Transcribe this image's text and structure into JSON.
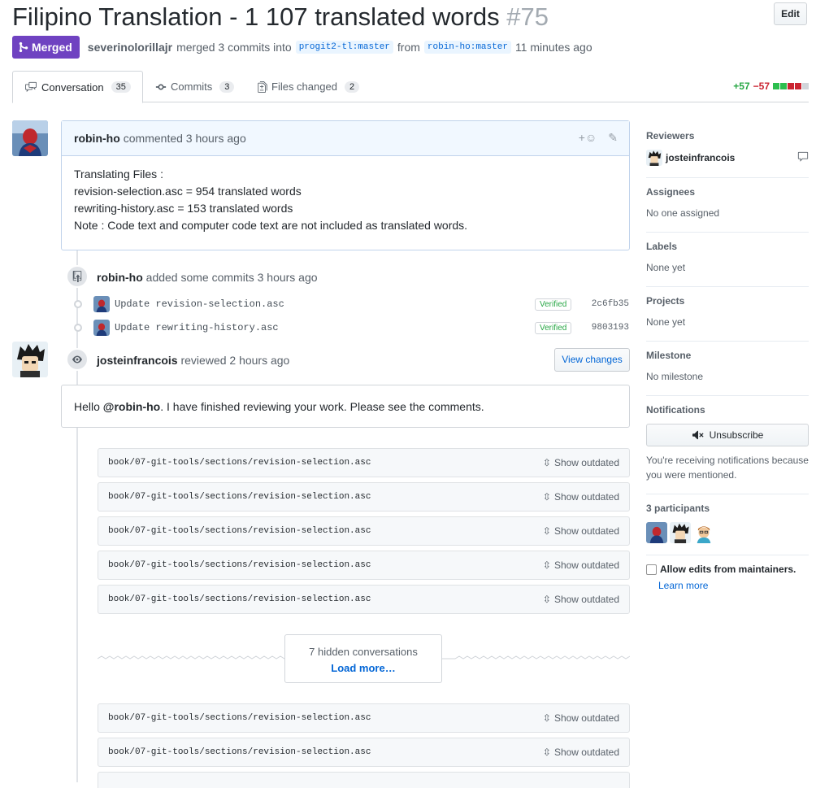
{
  "header": {
    "title": "Filipino Translation - 1 107 translated words",
    "number": "#75",
    "edit_label": "Edit",
    "state_label": "Merged",
    "merged_by": "severinolorillajr",
    "merged_text": "merged 3 commits into",
    "base_branch": "progit2-tl:master",
    "from_text": "from",
    "head_branch": "robin-ho:master",
    "time": "11 minutes ago"
  },
  "tabs": [
    {
      "label": "Conversation",
      "count": "35",
      "icon": "comment-discussion-icon"
    },
    {
      "label": "Commits",
      "count": "3",
      "icon": "git-commit-icon"
    },
    {
      "label": "Files changed",
      "count": "2",
      "icon": "file-diff-icon"
    }
  ],
  "diffstat": {
    "additions": "+57",
    "deletions": "−57",
    "colors": [
      "#2cbe4e",
      "#2cbe4e",
      "#cb2431",
      "#cb2431",
      "#d1d5da"
    ]
  },
  "comment": {
    "author": "robin-ho",
    "action": "commented 3 hours ago",
    "lines": [
      "Translating Files :",
      "revision-selection.asc = 954 translated words",
      "rewriting-history.asc = 153 translated words",
      "Note : Code text and computer code text are not included as translated words."
    ]
  },
  "commits_event": {
    "author": "robin-ho",
    "action": "added some commits 3 hours ago",
    "commits": [
      {
        "message": "Update revision-selection.asc",
        "badge": "Verified",
        "sha": "2c6fb35"
      },
      {
        "message": "Update rewriting-history.asc",
        "badge": "Verified",
        "sha": "9803193"
      }
    ]
  },
  "review_event": {
    "author": "josteinfrancois",
    "action": "reviewed 2 hours ago",
    "button": "View changes",
    "body_prefix": "Hello ",
    "mention": "@robin-ho",
    "body_suffix": ". I have finished reviewing your work. Please see the comments."
  },
  "review_files": [
    {
      "path": "book/07-git-tools/sections/revision-selection.asc",
      "action": "Show outdated"
    },
    {
      "path": "book/07-git-tools/sections/revision-selection.asc",
      "action": "Show outdated"
    },
    {
      "path": "book/07-git-tools/sections/revision-selection.asc",
      "action": "Show outdated"
    },
    {
      "path": "book/07-git-tools/sections/revision-selection.asc",
      "action": "Show outdated"
    },
    {
      "path": "book/07-git-tools/sections/revision-selection.asc",
      "action": "Show outdated"
    },
    {
      "path": "book/07-git-tools/sections/revision-selection.asc",
      "action": "Show outdated"
    },
    {
      "path": "book/07-git-tools/sections/revision-selection.asc",
      "action": "Show outdated"
    }
  ],
  "hidden": {
    "count": "7 hidden conversations",
    "load": "Load more…"
  },
  "sidebar": {
    "reviewers": {
      "heading": "Reviewers",
      "name": "josteinfrancois"
    },
    "assignees": {
      "heading": "Assignees",
      "value": "No one assigned"
    },
    "labels": {
      "heading": "Labels",
      "value": "None yet"
    },
    "projects": {
      "heading": "Projects",
      "value": "None yet"
    },
    "milestone": {
      "heading": "Milestone",
      "value": "No milestone"
    },
    "notifications": {
      "heading": "Notifications",
      "button": "Unsubscribe",
      "reason": "You're receiving notifications because you were mentioned."
    },
    "participants": {
      "heading": "3 participants"
    },
    "allow_edits": {
      "label": "Allow edits from maintainers.",
      "checked": false,
      "learn": "Learn more"
    }
  },
  "colors": {
    "merged": "#6f42c1",
    "link": "#0366d6",
    "add": "#28a745",
    "del": "#cb2431"
  }
}
